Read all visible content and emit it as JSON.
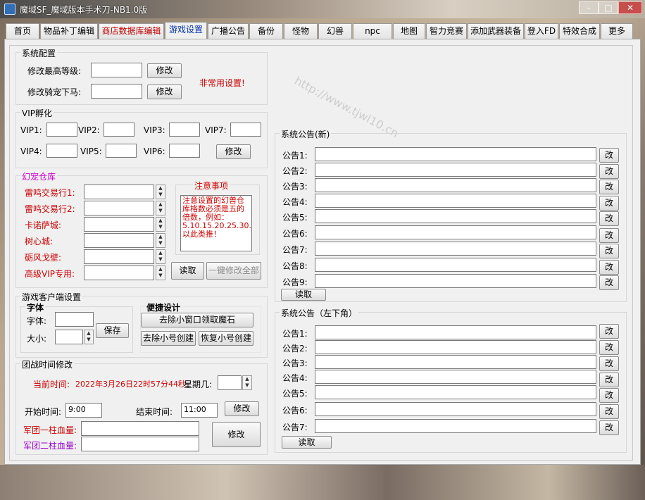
{
  "window": {
    "title": "魔域SF_魔域版本手术刀-NB1.0版",
    "min_glyph": "–",
    "max_glyph": "□",
    "close_glyph": "✕"
  },
  "tabs": [
    {
      "label": "首页"
    },
    {
      "label": "物品补丁编辑"
    },
    {
      "label": "商店数据库编辑"
    },
    {
      "label": "游戏设置"
    },
    {
      "label": "广播公告"
    },
    {
      "label": "备份"
    },
    {
      "label": "怪物"
    },
    {
      "label": "幻兽"
    },
    {
      "label": "npc"
    },
    {
      "label": "地图"
    },
    {
      "label": "智力竞赛"
    },
    {
      "label": "添加武器装备"
    },
    {
      "label": "登入FD"
    },
    {
      "label": "特效合成"
    },
    {
      "label": "更多"
    }
  ],
  "watermark": "http://www.tjwl10.cn",
  "system_config": {
    "title": "系统配置",
    "max_level_label": "修改最高等级:",
    "mount_label": "修改骑宠下马:",
    "modify_label": "修改",
    "rare_settings": "非常用设置!"
  },
  "vip": {
    "title": "VIP孵化",
    "labels": [
      "VIP1:",
      "VIP2:",
      "VIP3:",
      "VIP7:",
      "VIP4:",
      "VIP5:",
      "VIP6:"
    ],
    "modify_label": "修改"
  },
  "pet_warehouse": {
    "title": "幻宠仓库",
    "items": [
      "雷鸣交易行1:",
      "雷鸣交易行2:",
      "卡诺萨城:",
      "树心城:",
      "砺风戈壁:",
      "高级VIP专用:"
    ],
    "notice_title": "注意事项",
    "notice_text": "注意设置的幻兽仓库格数必须是五的倍数，例如：5.10.15.20.25.30.以此类推！",
    "read_label": "读取",
    "modify_all_label": "一键修改全部"
  },
  "client": {
    "title": "游戏客户端设置",
    "font_group": "字体",
    "font_label": "字体:",
    "size_label": "大小:",
    "save_label": "保存",
    "quick_title": "便捷设计",
    "remove_stone": "去除小窗口领取魔石",
    "remove_create": "去除小号创建",
    "restore_create": "恢复小号创建"
  },
  "legion": {
    "title": "团战时间修改",
    "current_time_label": "当前时间:",
    "current_time_value": "2022年3月26日22时57分44秒",
    "weekday_label": "星期几:",
    "start_label": "开始时间:",
    "start_value": "9:00",
    "end_label": "结束时间:",
    "end_value": "11:00",
    "modify_label": "修改",
    "hp1_label": "军团一柱血量:",
    "hp2_label": "军团二柱血量:",
    "modify_big_label": "修改"
  },
  "announce_new": {
    "title": "系统公告(新)",
    "labels": [
      "公告1:",
      "公告2:",
      "公告3:",
      "公告4:",
      "公告5:",
      "公告6:",
      "公告7:",
      "公告8:",
      "公告9:"
    ],
    "edit_label": "改",
    "read_label": "读取"
  },
  "announce_bottom": {
    "title": "系统公告（左下角）",
    "labels": [
      "公告1:",
      "公告2:",
      "公告3:",
      "公告4:",
      "公告5:",
      "公告6:",
      "公告7:"
    ],
    "edit_label": "改",
    "read_label": "读取"
  }
}
